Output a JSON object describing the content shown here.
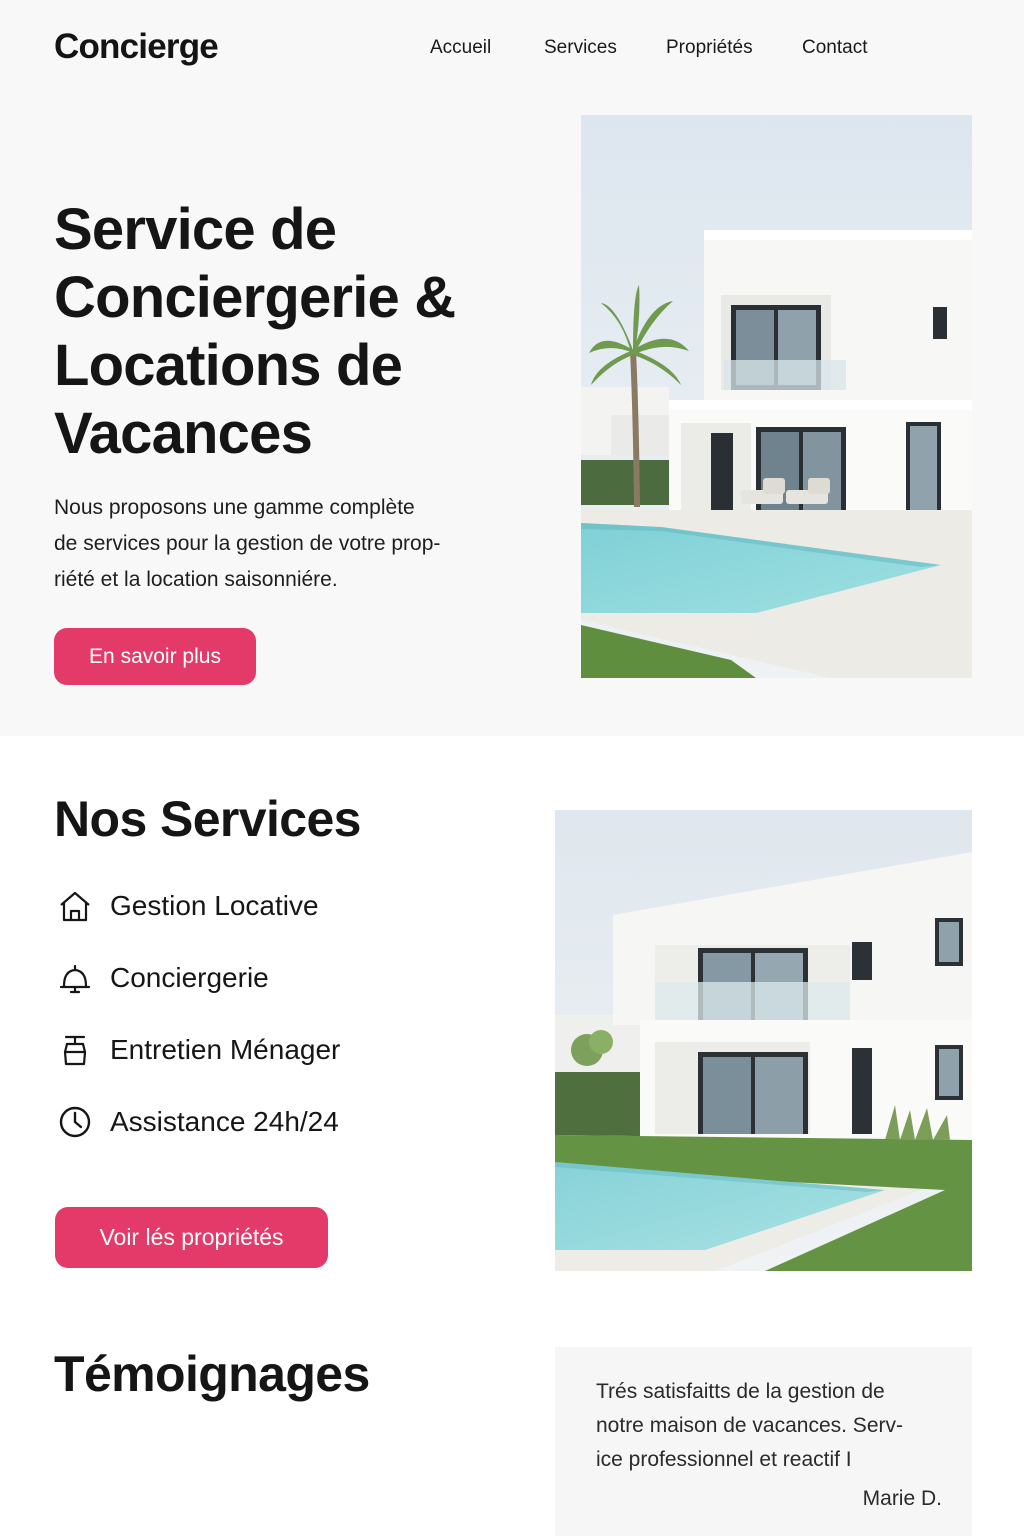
{
  "brand": {
    "logo": "Concierge",
    "accent_color": "#e33a6a"
  },
  "nav": {
    "items": [
      "Accueil",
      "Services",
      "Propriétés",
      "Contact"
    ]
  },
  "hero": {
    "title_lines": [
      "Service de",
      "Conciergerie &",
      "Locations de",
      "Vacances"
    ],
    "text_lines": [
      "Nous proposons une gamme complète",
      "de services pour la gestion de votre prop-",
      "riété et la location saisonniére."
    ],
    "button_label": "En savoir plus",
    "image": "villa-with-pool-and-palm-photo"
  },
  "services": {
    "title": "Nos Services",
    "items": [
      {
        "label": "Gestion Locative",
        "icon": "house-icon"
      },
      {
        "label": "Conciergerie",
        "icon": "service-bell-icon"
      },
      {
        "label": "Entretien Ménager",
        "icon": "cleaning-icon"
      },
      {
        "label": "Assistance 24h/24",
        "icon": "clock-icon"
      }
    ],
    "button_label": "Voir lés propriétés",
    "image": "white-villa-with-pool-photo"
  },
  "testimonials": {
    "title": "Témoignages",
    "quote_lines": [
      "Trés satisfaitts de la gestion de",
      "notre maison de vacances. Serv-",
      "ice professionnel et reactif I"
    ],
    "author": "Marie D."
  }
}
